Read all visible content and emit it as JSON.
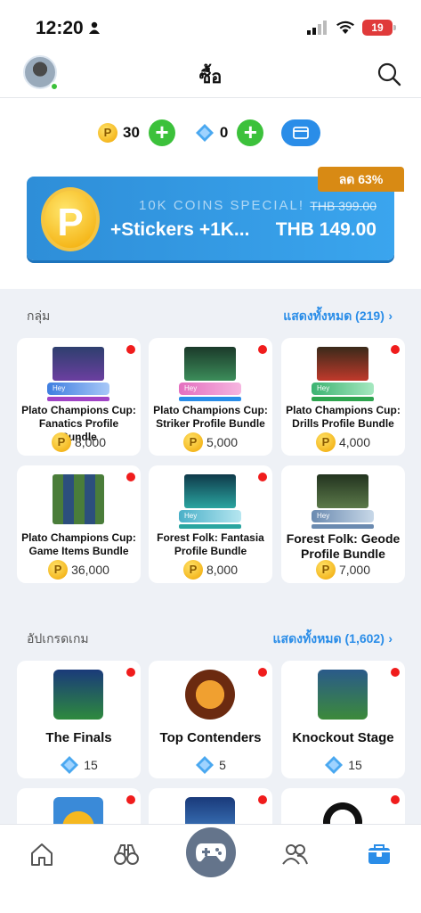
{
  "status_bar": {
    "time": "12:20",
    "battery": "19"
  },
  "header": {
    "title": "ซื้อ"
  },
  "wallet": {
    "coins": "30",
    "gems": "0",
    "coin_glyph": "P"
  },
  "banner": {
    "subtitle": "10K COINS SPECIAL!",
    "title": "+Stickers +1K...",
    "old_price": "THB 399.00",
    "price": "THB 149.00",
    "discount": "ลด 63%"
  },
  "groups": {
    "title": "กลุ่ม",
    "show_all": "แสดงทั้งหมด (219)",
    "items": [
      {
        "name": "Plato Champions Cup: Fanatics Profile Bundle",
        "price": "8,000"
      },
      {
        "name": "Plato Champions Cup: Striker Profile Bundle",
        "price": "5,000"
      },
      {
        "name": "Plato Champions Cup: Drills Profile Bundle",
        "price": "4,000"
      },
      {
        "name": "Plato Champions Cup: Game Items Bundle",
        "price": "36,000"
      },
      {
        "name": "Forest Folk: Fantasia Profile Bundle",
        "price": "8,000"
      },
      {
        "name": "Forest Folk: Geode Profile Bundle",
        "price": "7,000"
      }
    ]
  },
  "upgrades": {
    "title": "อัปเกรดเกม",
    "show_all": "แสดงทั้งหมด (1,602)",
    "items": [
      {
        "name": "The Finals",
        "price": "15"
      },
      {
        "name": "Top Contenders",
        "price": "5"
      },
      {
        "name": "Knockout Stage",
        "price": "15"
      }
    ]
  },
  "colors": {
    "accent": "#2a8de8",
    "green": "#3cc13b",
    "red": "#f01c1c",
    "discount": "#d88a14"
  }
}
